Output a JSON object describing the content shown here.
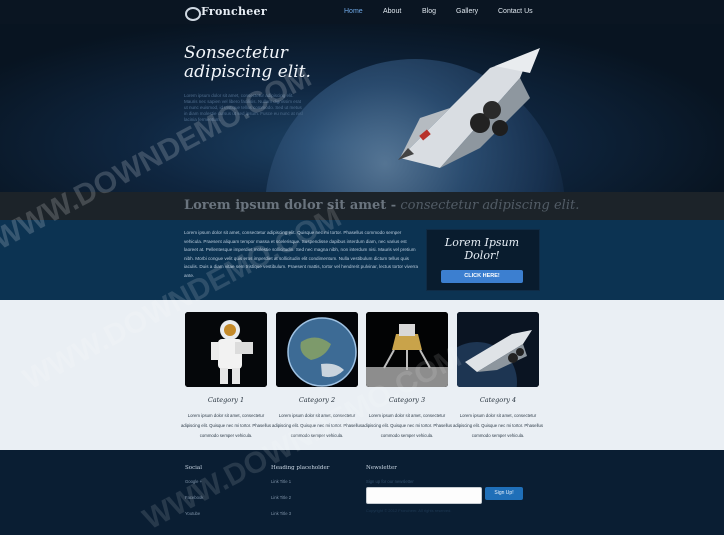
{
  "brand": {
    "logo_text": "Froncheer"
  },
  "nav": {
    "items": [
      "Home",
      "About",
      "Blog",
      "Gallery",
      "Contact Us"
    ],
    "active": "Home"
  },
  "hero": {
    "title_line1": "Sonsectetur",
    "title_line2": "adipiscing elit.",
    "body": "Lorem ipsum dolor sit amet, consectetur adipiscing elit. Mauris nec sapien vel libero facilisis. Nullam dignissim erat ut nunc euismod, id tristique tellus commodo. Sed ut metus in diam molestie cursus ut sed ipsum. Fusce eu nunc at nisl lacinia fermentum."
  },
  "tagline": {
    "bold": "Lorem ipsum dolor sit amet -",
    "italic": " consectetur adipiscing elit."
  },
  "intro": {
    "body": "Lorem ipsum dolor sit amet, consectetur adipiscing elit. Quisque nec mi tortor. Phasellus commodo semper vehicula. Praesent aliquam tempor massa et scelerisque. Suspendisse dapibus interdum diam, nec varius est laoreet at. Pellentesque imperdiet molestie sollicitudin. Sed nec magna nibh, non interdum nisi. Mauris vel pretium nibh. Morbi congue velit quis eros imperdiet at sollicitudin elit condimentum. Nulla vestibulum dictum tellus quis iaculis. Duis a diam vitae sem tristique vestibulum. Praesent mattis, tortor vel hendrerit pulvinar, lectus tortor viverra ante.",
    "promo_title": "Lorem Ipsum Dolor!",
    "promo_button": "CLICK HERE!"
  },
  "categories": [
    {
      "title": "Category 1",
      "text": "Lorem ipsum dolor sit amet, consectetur adipiscing elit. Quisque nec mi tortor. Phasellus commodo semper vehicula.",
      "image": "astronaut"
    },
    {
      "title": "Category 2",
      "text": "Lorem ipsum dolor sit amet, consectetur adipiscing elit. Quisque nec mi tortor. Phasellus commodo semper vehicula.",
      "image": "earth"
    },
    {
      "title": "Category 3",
      "text": "Lorem ipsum dolor sit amet, consectetur adipiscing elit. Quisque nec mi tortor. Phasellus commodo semper vehicula.",
      "image": "lunar-lander"
    },
    {
      "title": "Category 4",
      "text": "Lorem ipsum dolor sit amet, consectetur adipiscing elit. Quisque nec mi tortor. Phasellus commodo semper vehicula.",
      "image": "space-shuttle"
    }
  ],
  "footer": {
    "social": {
      "heading": "Social",
      "links": [
        "Google +",
        "Facebook",
        "Youtube"
      ]
    },
    "headings": {
      "heading": "Heading placeholder",
      "links": [
        "Link Title 1",
        "Link Title 2",
        "Link Title 3"
      ]
    },
    "newsletter": {
      "heading": "Newsletter",
      "subtext": "Sign up for our newsletter",
      "input_value": "",
      "button": "Sign Up!",
      "copyright": "Copyright © 2012 Froncheer. All rights reserved."
    }
  },
  "watermark": {
    "text": "WWW.DOWNDEMO.COM"
  },
  "colors": {
    "accent": "#3c7fd0",
    "nav_active": "#6fa8e6",
    "intro_band": "#0c3352",
    "category_band": "#eaeff4",
    "footer": "#0a1e33"
  }
}
